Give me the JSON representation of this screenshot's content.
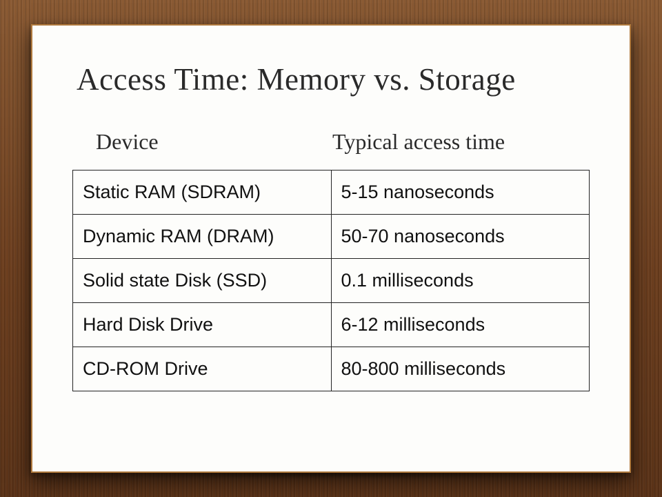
{
  "title": "Access Time: Memory vs. Storage",
  "columns": {
    "device": "Device",
    "time": "Typical access time"
  },
  "rows": [
    {
      "device": "Static RAM (SDRAM)",
      "time": "5-15 nanoseconds"
    },
    {
      "device": "Dynamic RAM (DRAM)",
      "time": "50-70 nanoseconds"
    },
    {
      "device": "Solid state Disk (SSD)",
      "time": "0.1 milliseconds"
    },
    {
      "device": "Hard Disk Drive",
      "time": "6-12 milliseconds"
    },
    {
      "device": "CD-ROM Drive",
      "time": "80-800 milliseconds"
    }
  ],
  "chart_data": {
    "type": "table",
    "title": "Access Time: Memory vs. Storage",
    "columns": [
      "Device",
      "Typical access time"
    ],
    "rows": [
      [
        "Static RAM (SDRAM)",
        "5-15 nanoseconds"
      ],
      [
        "Dynamic RAM (DRAM)",
        "50-70 nanoseconds"
      ],
      [
        "Solid state Disk (SSD)",
        "0.1 milliseconds"
      ],
      [
        "Hard Disk Drive",
        "6-12 milliseconds"
      ],
      [
        "CD-ROM Drive",
        "80-800 milliseconds"
      ]
    ]
  }
}
